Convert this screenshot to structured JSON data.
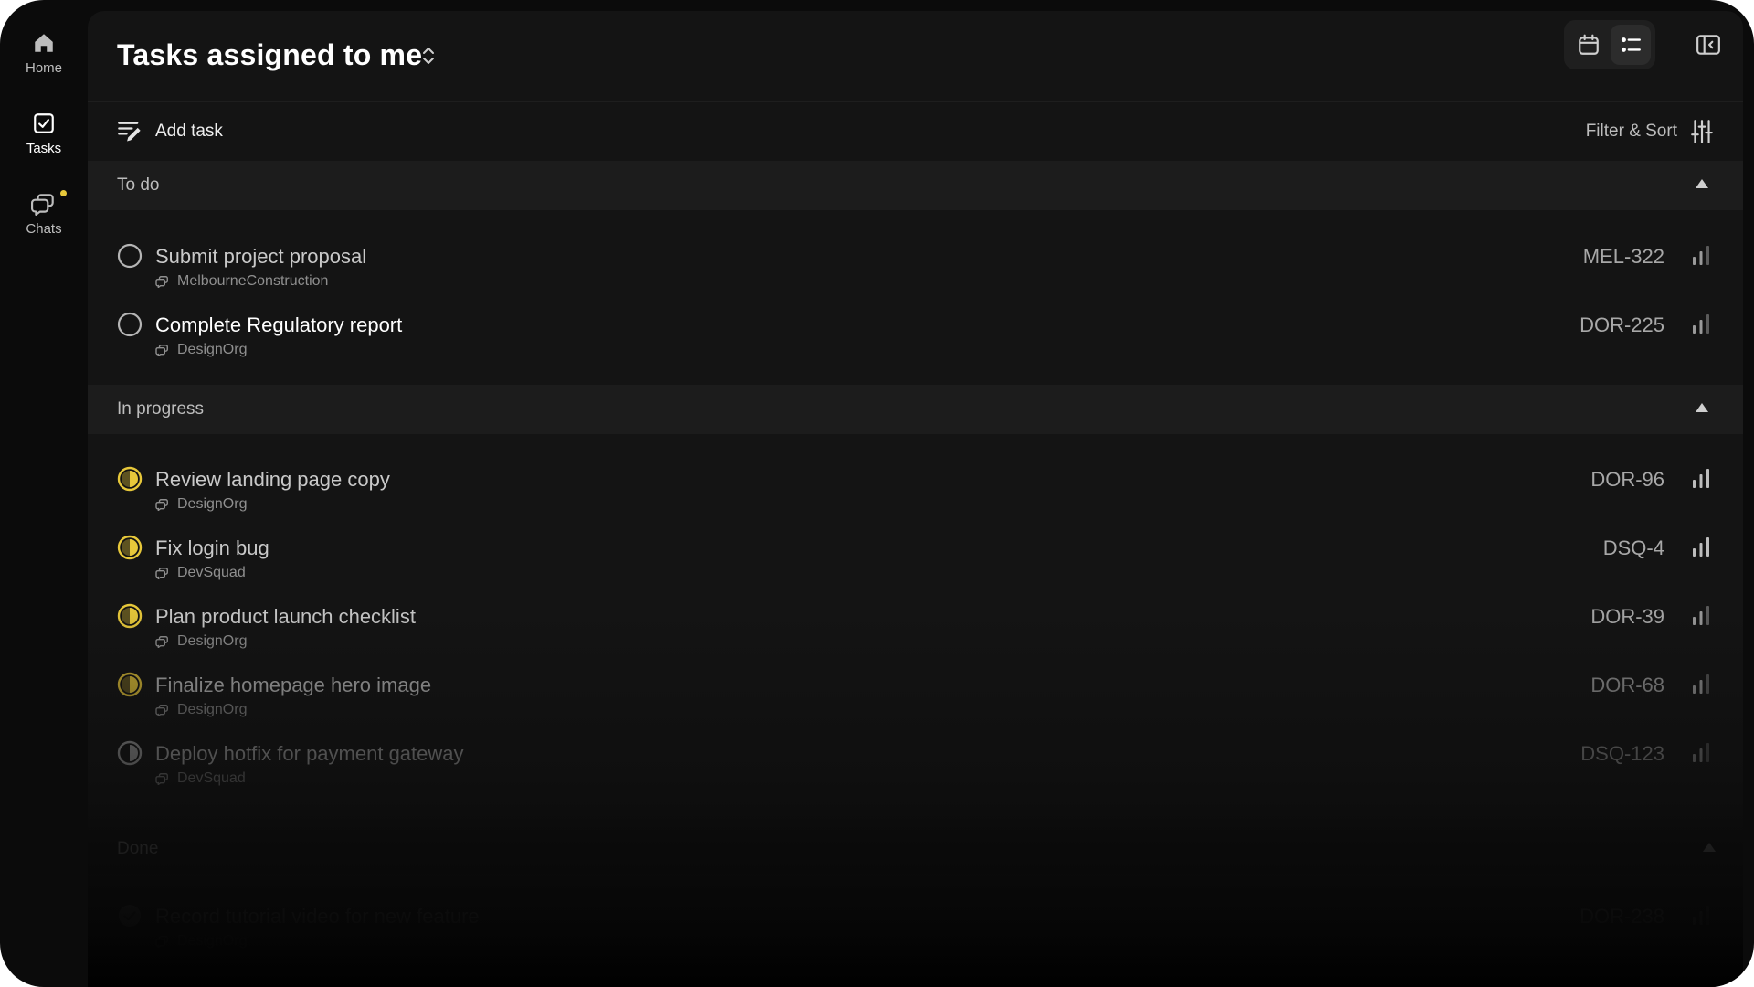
{
  "nav": {
    "items": [
      {
        "label": "Home",
        "icon": "home-icon"
      },
      {
        "label": "Tasks",
        "icon": "task-check-icon",
        "active": true
      },
      {
        "label": "Chats",
        "icon": "chat-bubbles-icon",
        "badge": true
      }
    ]
  },
  "header": {
    "title": "Tasks assigned to me",
    "view_modes": [
      "calendar",
      "list"
    ],
    "active_view": "list"
  },
  "toolbar": {
    "add_task_label": "Add task",
    "filter_label": "Filter & Sort"
  },
  "colors": {
    "in_progress": "#e7c83a",
    "background": "#141414",
    "section_bg": "#1c1c1c"
  },
  "sections": [
    {
      "name": "To do",
      "tasks": [
        {
          "title": "Submit project proposal",
          "org": "MelbourneConstruction",
          "id": "MEL-322",
          "status": "todo"
        },
        {
          "title": "Complete Regulatory report",
          "org": "DesignOrg",
          "id": "DOR-225",
          "status": "todo"
        }
      ]
    },
    {
      "name": "In progress",
      "tasks": [
        {
          "title": "Review landing page copy",
          "org": "DesignOrg",
          "id": "DOR-96",
          "status": "in-progress"
        },
        {
          "title": "Fix login bug",
          "org": "DevSquad",
          "id": "DSQ-4",
          "status": "in-progress"
        },
        {
          "title": "Plan product launch checklist",
          "org": "DesignOrg",
          "id": "DOR-39",
          "status": "in-progress"
        },
        {
          "title": "Finalize homepage hero image",
          "org": "DesignOrg",
          "id": "DOR-68",
          "status": "in-progress"
        },
        {
          "title": "Deploy hotfix for payment gateway",
          "org": "DevSquad",
          "id": "DSQ-123",
          "status": "in-progress-grey"
        }
      ]
    },
    {
      "name": "Done",
      "tasks": [
        {
          "title": "Record tutorial video for new feature",
          "org": "DesignOrg",
          "id": "DOR-238",
          "status": "done"
        }
      ]
    }
  ]
}
